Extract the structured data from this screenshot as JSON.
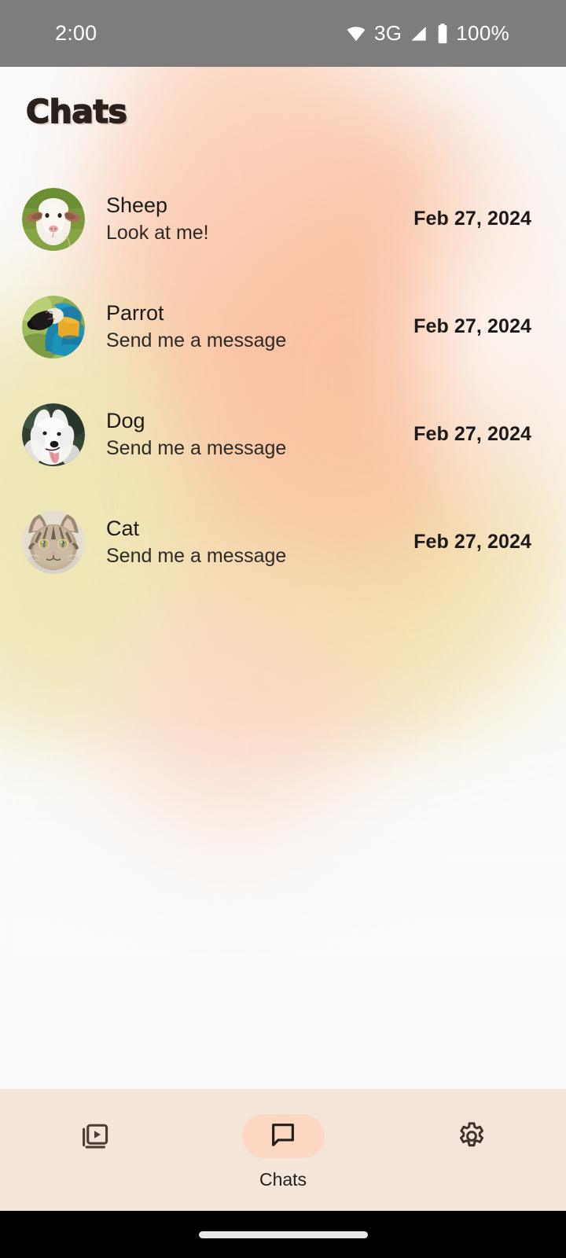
{
  "status_bar": {
    "time": "2:00",
    "network": "3G",
    "battery": "100%",
    "icons": [
      "wifi-icon",
      "signal-icon",
      "battery-icon"
    ],
    "background_color": "#7d7d7d",
    "text_color": "#ffffff"
  },
  "header": {
    "title": "Chats",
    "title_color": "#2a201c"
  },
  "theme": {
    "accent": "#fcd7c1",
    "navbar_background": "#f4e5da",
    "page_background": "#fafafa",
    "blob_peach": "#fbc6a8",
    "blob_yellow": "#efe6b4"
  },
  "chats": [
    {
      "name": "Sheep",
      "snippet": "Look at me!",
      "date": "Feb 27, 2024",
      "avatar": "sheep-avatar"
    },
    {
      "name": "Parrot",
      "snippet": "Send me a message",
      "date": "Feb 27, 2024",
      "avatar": "parrot-avatar"
    },
    {
      "name": "Dog",
      "snippet": "Send me a message",
      "date": "Feb 27, 2024",
      "avatar": "dog-avatar"
    },
    {
      "name": "Cat",
      "snippet": "Send me a message",
      "date": "Feb 27, 2024",
      "avatar": "cat-avatar"
    }
  ],
  "bottom_nav": {
    "items": [
      {
        "label": "",
        "icon": "slideshow-icon",
        "active": false
      },
      {
        "label": "Chats",
        "icon": "chat-bubble-icon",
        "active": true
      },
      {
        "label": "",
        "icon": "gear-icon",
        "active": false
      }
    ]
  }
}
